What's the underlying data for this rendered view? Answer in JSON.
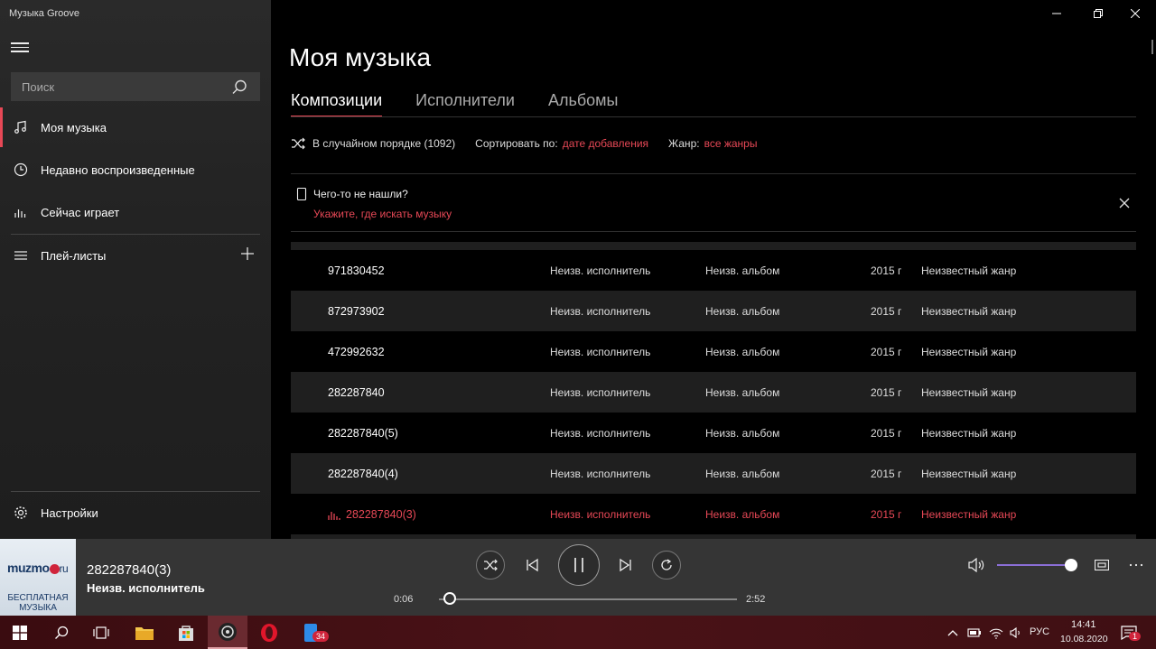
{
  "app": {
    "title": "Музыка Groove"
  },
  "colors": {
    "accent": "#e74856",
    "volume": "#8b6fd6"
  },
  "sidebar": {
    "search_placeholder": "Поиск",
    "items": [
      {
        "label": "Моя музыка",
        "icon": "music-note-icon"
      },
      {
        "label": "Недавно воспроизведенные",
        "icon": "clock-icon"
      },
      {
        "label": "Сейчас играет",
        "icon": "equalizer-icon"
      },
      {
        "label": "Плей-листы",
        "icon": "playlist-icon"
      }
    ],
    "settings_label": "Настройки"
  },
  "main": {
    "title": "Моя музыка",
    "tabs": [
      {
        "label": "Композиции"
      },
      {
        "label": "Исполнители"
      },
      {
        "label": "Альбомы"
      }
    ],
    "filters": {
      "shuffle_label": "В случайном порядке (1092)",
      "sort_label": "Сортировать по:",
      "sort_value": "дате добавления",
      "genre_label": "Жанр:",
      "genre_value": "все жанры"
    },
    "notice": {
      "question": "Чего-то не нашли?",
      "link": "Укажите, где искать музыку"
    },
    "songs": [
      {
        "title": "971830452",
        "artist": "Неизв. исполнитель",
        "album": "Неизв. альбом",
        "year": "2015 г",
        "genre": "Неизвестный жанр"
      },
      {
        "title": "872973902",
        "artist": "Неизв. исполнитель",
        "album": "Неизв. альбом",
        "year": "2015 г",
        "genre": "Неизвестный жанр"
      },
      {
        "title": "472992632",
        "artist": "Неизв. исполнитель",
        "album": "Неизв. альбом",
        "year": "2015 г",
        "genre": "Неизвестный жанр"
      },
      {
        "title": "282287840",
        "artist": "Неизв. исполнитель",
        "album": "Неизв. альбом",
        "year": "2015 г",
        "genre": "Неизвестный жанр"
      },
      {
        "title": "282287840(5)",
        "artist": "Неизв. исполнитель",
        "album": "Неизв. альбом",
        "year": "2015 г",
        "genre": "Неизвестный жанр"
      },
      {
        "title": "282287840(4)",
        "artist": "Неизв. исполнитель",
        "album": "Неизв. альбом",
        "year": "2015 г",
        "genre": "Неизвестный жанр"
      },
      {
        "title": "282287840(3)",
        "artist": "Неизв. исполнитель",
        "album": "Неизв. альбом",
        "year": "2015 г",
        "genre": "Неизвестный жанр"
      }
    ]
  },
  "player": {
    "art_logo": "muzmo",
    "art_logo_suffix": "ru",
    "art_caption": "БЕСПЛАТНАЯ МУЗЫКА",
    "title": "282287840(3)",
    "artist": "Неизв. исполнитель",
    "elapsed": "0:06",
    "duration": "2:52",
    "progress_fraction": 0.035,
    "volume_fraction": 1.0
  },
  "taskbar": {
    "lang": "РУС",
    "time": "14:41",
    "date": "10.08.2020",
    "app_badge": "34",
    "notif_badge": "1"
  }
}
